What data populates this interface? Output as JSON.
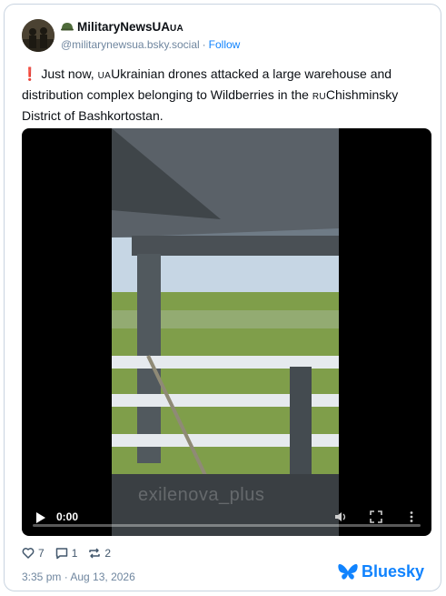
{
  "author": {
    "display_name": "MilitaryNewsUA",
    "display_name_flag": "UA",
    "handle": "@militarynewsua.bsky.social",
    "separator": "·",
    "follow_label": "Follow"
  },
  "post": {
    "text_part1": " Just now, ",
    "flag_ua": "UA",
    "text_part2": "Ukrainian drones attacked a large warehouse and distribution complex belonging to Wildberries in the ",
    "flag_ru": "RU",
    "text_part3": "Chishminsky District of Bashkortostan."
  },
  "video": {
    "current_time": "0:00",
    "progress": 0,
    "watermark": "exilenova_plus"
  },
  "actions": {
    "likes": "7",
    "replies": "1",
    "reposts": "2"
  },
  "timestamp": "3:35 pm · Aug 13, 2026",
  "brand": {
    "name": "Bluesky",
    "color": "#1083fe"
  },
  "icons": {
    "avatar": "soldiers-avatar",
    "helmet": "helmet-icon",
    "exclamation": "red-exclamation-icon",
    "like": "heart-icon",
    "reply": "comment-icon",
    "repost": "repost-icon",
    "brand": "butterfly-icon"
  }
}
